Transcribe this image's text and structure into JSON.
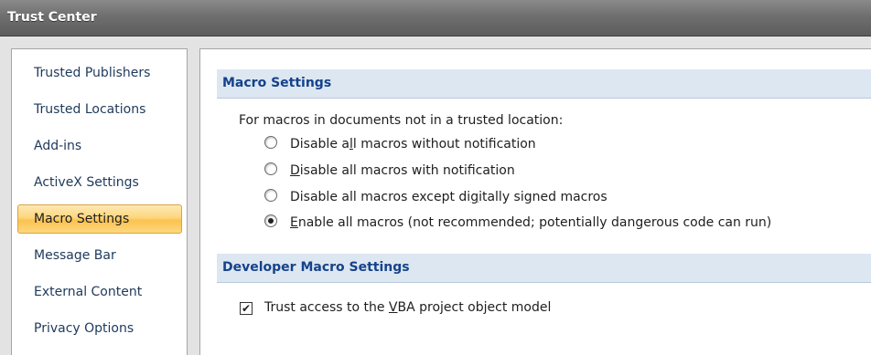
{
  "window": {
    "title": "Trust Center"
  },
  "sidebar": {
    "items": [
      {
        "label": "Trusted Publishers",
        "selected": false
      },
      {
        "label": "Trusted Locations",
        "selected": false
      },
      {
        "label": "Add-ins",
        "selected": false
      },
      {
        "label": "ActiveX Settings",
        "selected": false
      },
      {
        "label": "Macro Settings",
        "selected": true
      },
      {
        "label": "Message Bar",
        "selected": false
      },
      {
        "label": "External Content",
        "selected": false
      },
      {
        "label": "Privacy Options",
        "selected": false
      }
    ]
  },
  "macro_settings": {
    "header": "Macro Settings",
    "intro": "For macros in documents not in a trusted location:",
    "options": [
      {
        "pre": "Disable a",
        "key": "l",
        "post": "l macros without notification",
        "checked": false
      },
      {
        "pre": "",
        "key": "D",
        "post": "isable all macros with notification",
        "checked": false
      },
      {
        "pre": "Disable all macros except di",
        "key": "g",
        "post": "itally signed macros",
        "checked": false
      },
      {
        "pre": "",
        "key": "E",
        "post": "nable all macros (not recommended; potentially dangerous code can run)",
        "checked": true
      }
    ]
  },
  "developer_settings": {
    "header": "Developer Macro Settings",
    "trust_vba": {
      "pre": "Trust access to the ",
      "key": "V",
      "post": "BA project object model",
      "checked": true,
      "mark": "✔"
    }
  }
}
